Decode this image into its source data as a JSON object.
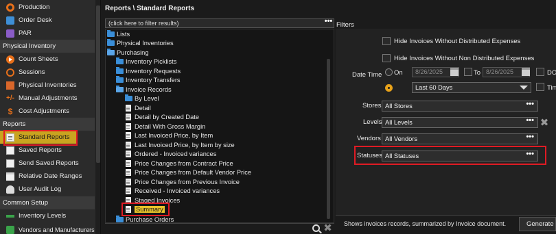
{
  "sidebar": {
    "items": [
      {
        "label": "Production",
        "icon": "production-icon"
      },
      {
        "label": "Order Desk",
        "icon": "order-desk-icon"
      },
      {
        "label": "PAR",
        "icon": "par-icon"
      }
    ],
    "sections": [
      {
        "title": "Physical Inventory",
        "items": [
          "Count Sheets",
          "Sessions",
          "Physical Inventories",
          "Manual Adjustments",
          "Cost Adjustments"
        ]
      },
      {
        "title": "Reports",
        "items": [
          "Standard Reports",
          "Saved Reports",
          "Send Saved Reports",
          "Relative Date Ranges",
          "User Audit Log"
        ]
      },
      {
        "title": "Common Setup",
        "items": [
          "Inventory Levels",
          "Vendors and Manufacturers"
        ]
      }
    ],
    "active_item": "Standard Reports",
    "accent_color": "#c9a420",
    "highlight_color": "#e01b24"
  },
  "tree_panel": {
    "breadcrumb": "Reports \\ Standard Reports",
    "filter_placeholder": "(click here to filter results)",
    "nodes": [
      {
        "label": "Lists",
        "type": "folder"
      },
      {
        "label": "Physical Inventories",
        "type": "folder"
      },
      {
        "label": "Purchasing",
        "type": "folder-open"
      },
      {
        "label": "Inventory Picklists",
        "type": "folder"
      },
      {
        "label": "Inventory Requests",
        "type": "folder"
      },
      {
        "label": "Inventory Transfers",
        "type": "folder"
      },
      {
        "label": "Invoice Records",
        "type": "folder-open"
      },
      {
        "label": "By Level",
        "type": "folder"
      },
      {
        "label": "Detail",
        "type": "doc"
      },
      {
        "label": "Detail by Created Date",
        "type": "doc"
      },
      {
        "label": "Detail With Gross Margin",
        "type": "doc"
      },
      {
        "label": "Last Invoiced Price, by Item",
        "type": "doc"
      },
      {
        "label": "Last Invoiced Price, by Item by size",
        "type": "doc"
      },
      {
        "label": "Ordered - Invoiced variances",
        "type": "doc"
      },
      {
        "label": "Price Changes from Contract Price",
        "type": "doc"
      },
      {
        "label": "Price Changes from Default Vendor Price",
        "type": "doc"
      },
      {
        "label": "Price Changes from Previous Invoice",
        "type": "doc"
      },
      {
        "label": "Received - Invoiced variances",
        "type": "doc"
      },
      {
        "label": "Staged Invoices",
        "type": "doc"
      },
      {
        "label": "Summary",
        "type": "doc",
        "selected": true
      },
      {
        "label": "Purchase Orders",
        "type": "folder"
      }
    ]
  },
  "filters": {
    "title": "Filters",
    "hide_distributed": "Hide Invoices Without Distributed Expenses",
    "hide_non_distributed": "Hide Invoices Without Non Distributed Expenses",
    "date_time_label": "Date Time",
    "on_label": "On",
    "date_from": "8/26/2025",
    "to_label": "To",
    "date_to": "8/26/2025",
    "do_label": "DO",
    "tim_label": "Tim",
    "relative_range": "Last 60 Days",
    "stores_label": "Stores",
    "stores_value": "All Stores",
    "levels_label": "Levels",
    "levels_value": "All Levels",
    "vendors_label": "Vendors",
    "vendors_value": "All Vendors",
    "statuses_label": "Statuses",
    "statuses_value": "All Statuses",
    "dots": "•••",
    "clear_symbol": "✖"
  },
  "footer": {
    "description": "Shows invoices records, summarized by Invoice document.",
    "generate_label": "Generate"
  }
}
